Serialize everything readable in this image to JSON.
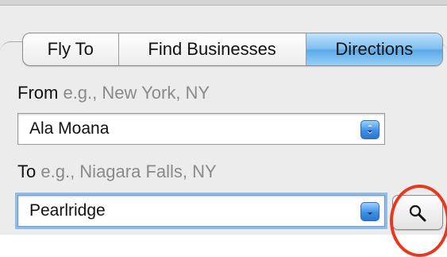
{
  "tabs": [
    {
      "label": "Fly To",
      "selected": false
    },
    {
      "label": "Find Businesses",
      "selected": false
    },
    {
      "label": "Directions",
      "selected": true
    }
  ],
  "from": {
    "label": "From",
    "hint": "e.g., New York, NY",
    "value": "Ala Moana"
  },
  "to": {
    "label": "To",
    "hint": "e.g., Niagara Falls, NY",
    "value": "Pearlridge"
  },
  "search_button": {
    "icon": "magnifier-icon"
  },
  "annotation": {
    "color": "#e53a1e",
    "shape": "circle"
  },
  "colors": {
    "selected_tab": "#7ec0f1",
    "focus_ring": "#8fbde8"
  }
}
